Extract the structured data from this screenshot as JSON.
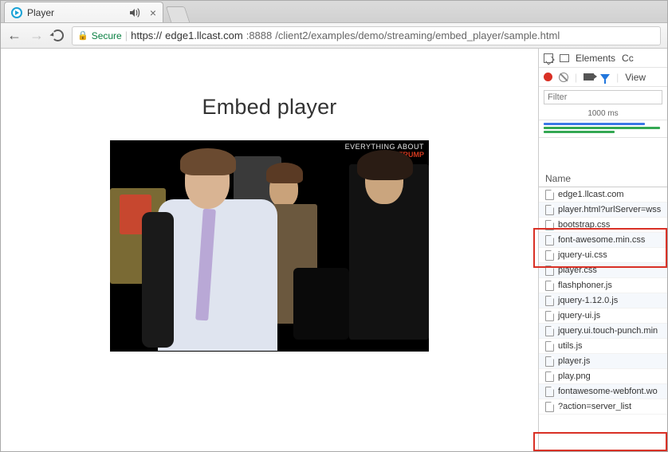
{
  "tab": {
    "title": "Player"
  },
  "url": {
    "secure_label": "Secure",
    "scheme": "https://",
    "host": "edge1.llcast.com",
    "port": ":8888",
    "path": "/client2/examples/demo/streaming/embed_player/sample.html"
  },
  "page": {
    "heading": "Embed player",
    "overlay_line1": "EVERYTHING ABOUT",
    "overlay_line2": "D    ALD TRUMP"
  },
  "devtools": {
    "tabs": {
      "elements": "Elements",
      "c": "Cc",
      "view": "View"
    },
    "filter_placeholder": "Filter",
    "timeline_label": "1000 ms",
    "name_header": "Name",
    "requests": [
      "edge1.llcast.com",
      "player.html?urlServer=wss",
      "bootstrap.css",
      "font-awesome.min.css",
      "jquery-ui.css",
      "player.css",
      "flashphoner.js",
      "jquery-1.12.0.js",
      "jquery-ui.js",
      "jquery.ui.touch-punch.min",
      "utils.js",
      "player.js",
      "play.png",
      "fontawesome-webfont.wo",
      "?action=server_list"
    ]
  }
}
